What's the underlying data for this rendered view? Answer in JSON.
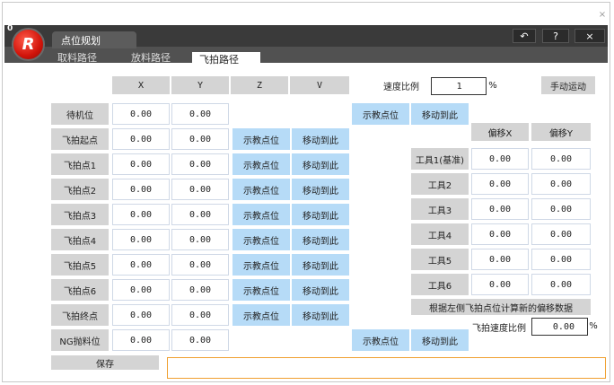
{
  "window": {
    "corner_label": "0",
    "logo_letter": "R",
    "app_tab": "点位规划",
    "btn_back": "↶",
    "btn_help": "?",
    "btn_close": "×",
    "outer_close": "×"
  },
  "subtabs": [
    "取料路径",
    "放料路径",
    "飞拍路径"
  ],
  "columns": [
    "X",
    "Y",
    "Z",
    "V"
  ],
  "speed": {
    "label": "速度比例",
    "value": "1",
    "unit": "%",
    "manual_button": "手动运动"
  },
  "teach_label": "示教点位",
  "move_label": "移动到此",
  "rows": [
    {
      "name": "待机位",
      "x": "0.00",
      "y": "0.00"
    },
    {
      "name": "飞拍起点",
      "x": "0.00",
      "y": "0.00"
    },
    {
      "name": "飞拍点1",
      "x": "0.00",
      "y": "0.00"
    },
    {
      "name": "飞拍点2",
      "x": "0.00",
      "y": "0.00"
    },
    {
      "name": "飞拍点3",
      "x": "0.00",
      "y": "0.00"
    },
    {
      "name": "飞拍点4",
      "x": "0.00",
      "y": "0.00"
    },
    {
      "name": "飞拍点5",
      "x": "0.00",
      "y": "0.00"
    },
    {
      "name": "飞拍点6",
      "x": "0.00",
      "y": "0.00"
    },
    {
      "name": "飞拍终点",
      "x": "0.00",
      "y": "0.00"
    },
    {
      "name": "NG抛料位",
      "x": "0.00",
      "y": "0.00"
    }
  ],
  "offset": {
    "header_x": "偏移X",
    "header_y": "偏移Y",
    "tools": [
      {
        "name": "工具1(基准)",
        "x": "0.00",
        "y": "0.00"
      },
      {
        "name": "工具2",
        "x": "0.00",
        "y": "0.00"
      },
      {
        "name": "工具3",
        "x": "0.00",
        "y": "0.00"
      },
      {
        "name": "工具4",
        "x": "0.00",
        "y": "0.00"
      },
      {
        "name": "工具5",
        "x": "0.00",
        "y": "0.00"
      },
      {
        "name": "工具6",
        "x": "0.00",
        "y": "0.00"
      }
    ],
    "compute_button": "根据左侧飞拍点位计算新的偏移数据"
  },
  "fly_speed": {
    "label": "飞拍速度比例",
    "value": "0.00",
    "unit": "%"
  },
  "save_button": "保存"
}
